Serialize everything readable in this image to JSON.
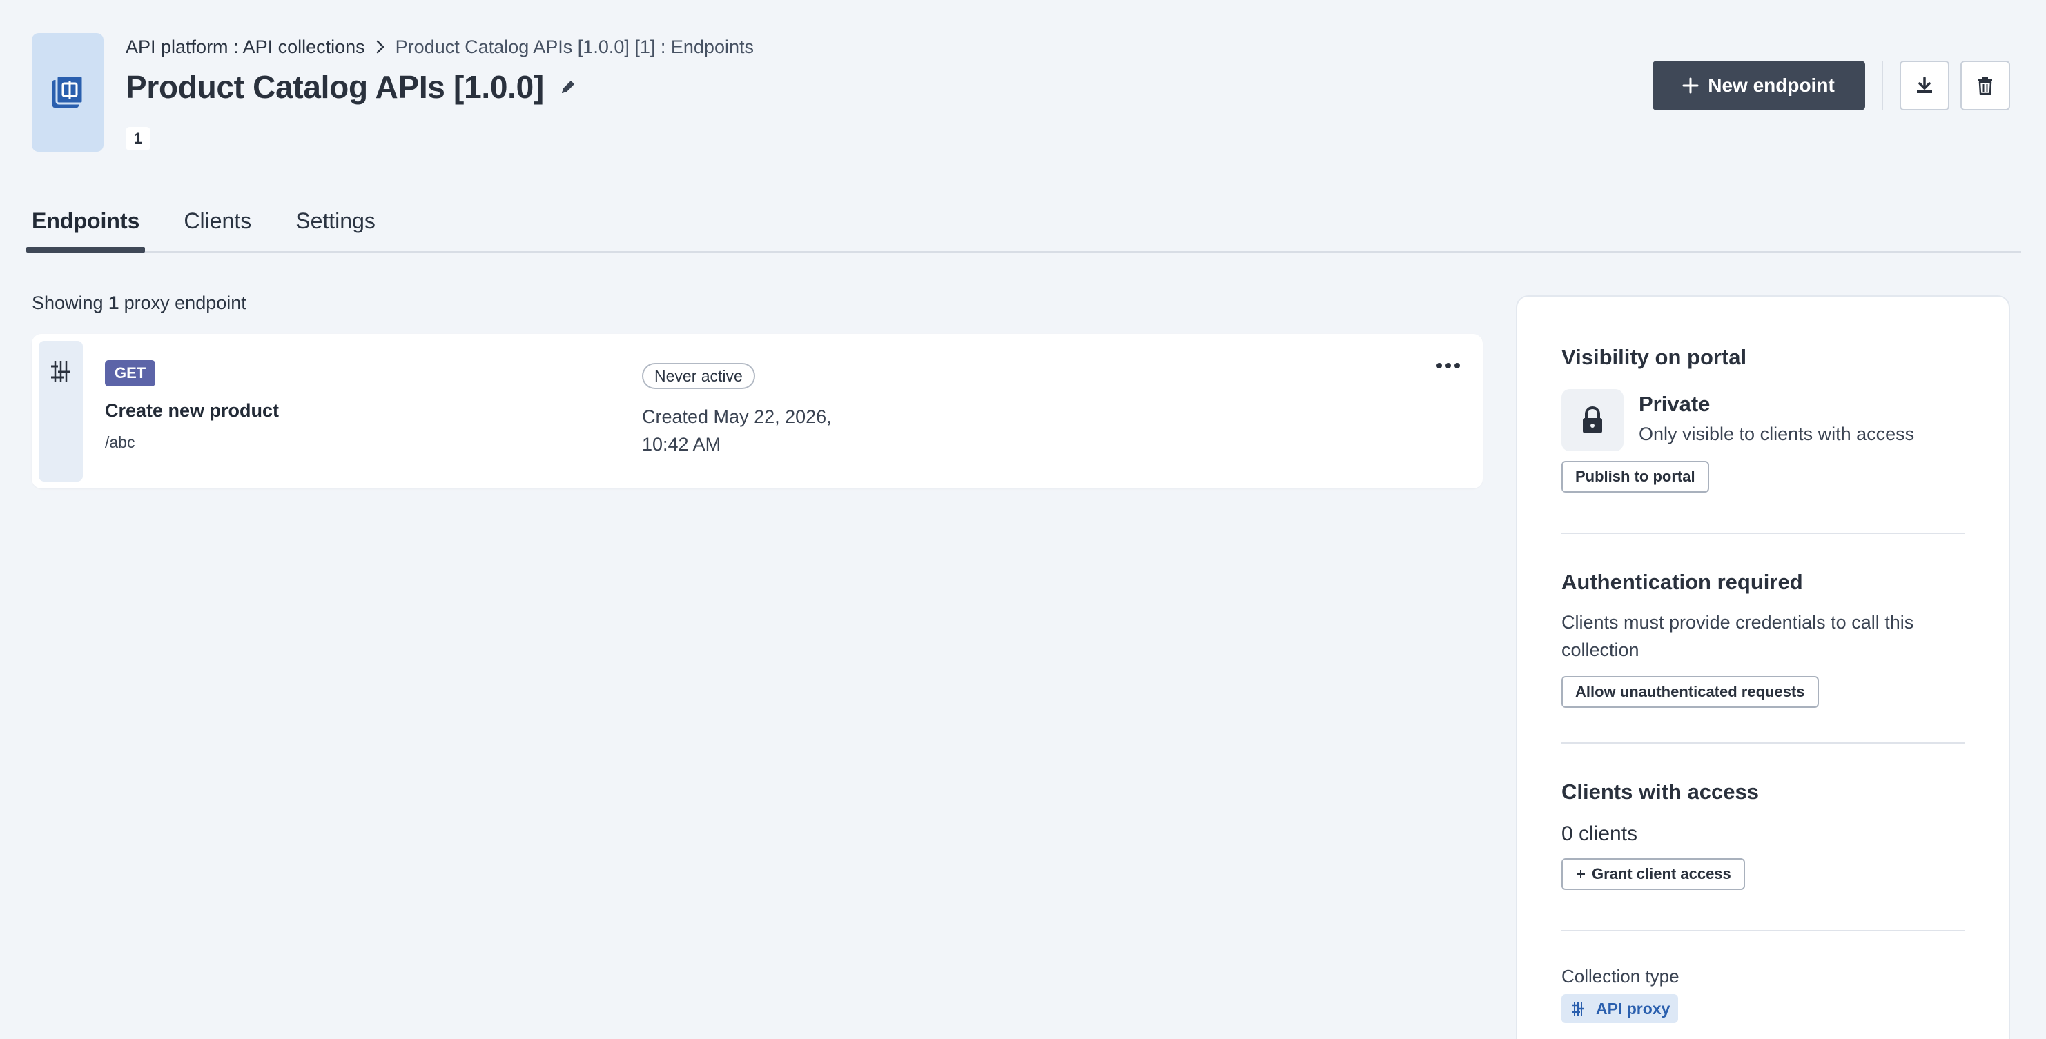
{
  "header": {
    "breadcrumb": {
      "parent": "API platform : API collections",
      "current": "Product Catalog APIs [1.0.0] [1] : Endpoints"
    },
    "title": "Product Catalog APIs [1.0.0]",
    "version_badge": "1",
    "new_endpoint_label": "New endpoint"
  },
  "tabs": [
    {
      "label": "Endpoints",
      "active": true
    },
    {
      "label": "Clients",
      "active": false
    },
    {
      "label": "Settings",
      "active": false
    }
  ],
  "main": {
    "showing_prefix": "Showing",
    "showing_count": "1",
    "showing_suffix": "proxy endpoint",
    "endpoints": [
      {
        "method": "GET",
        "name": "Create new product",
        "path": "/abc",
        "status": "Never active",
        "created": "Created May 22, 2026, 10:42 AM"
      }
    ]
  },
  "panel": {
    "visibility": {
      "title": "Visibility on portal",
      "state": "Private",
      "description": "Only visible to clients with access",
      "action_label": "Publish to portal"
    },
    "authentication": {
      "title": "Authentication required",
      "description": "Clients must provide credentials to call this collection",
      "action_label": "Allow unauthenticated requests"
    },
    "clients": {
      "title": "Clients with access",
      "count": "0 clients",
      "action_label": "Grant client access"
    },
    "collection_type": {
      "label": "Collection type",
      "value": "API proxy"
    }
  },
  "icons": {
    "collection": "api-collection-icon",
    "edit": "pencil-icon",
    "download": "download-icon",
    "delete": "trash-icon",
    "endpoint": "proxy-icon",
    "more": "ellipsis-icon",
    "lock": "lock-icon"
  },
  "colors": {
    "primary_button": "#3f4857",
    "method_get": "#5c64a8",
    "accent_blue": "#2a5fae",
    "background": "#f2f5f9"
  }
}
